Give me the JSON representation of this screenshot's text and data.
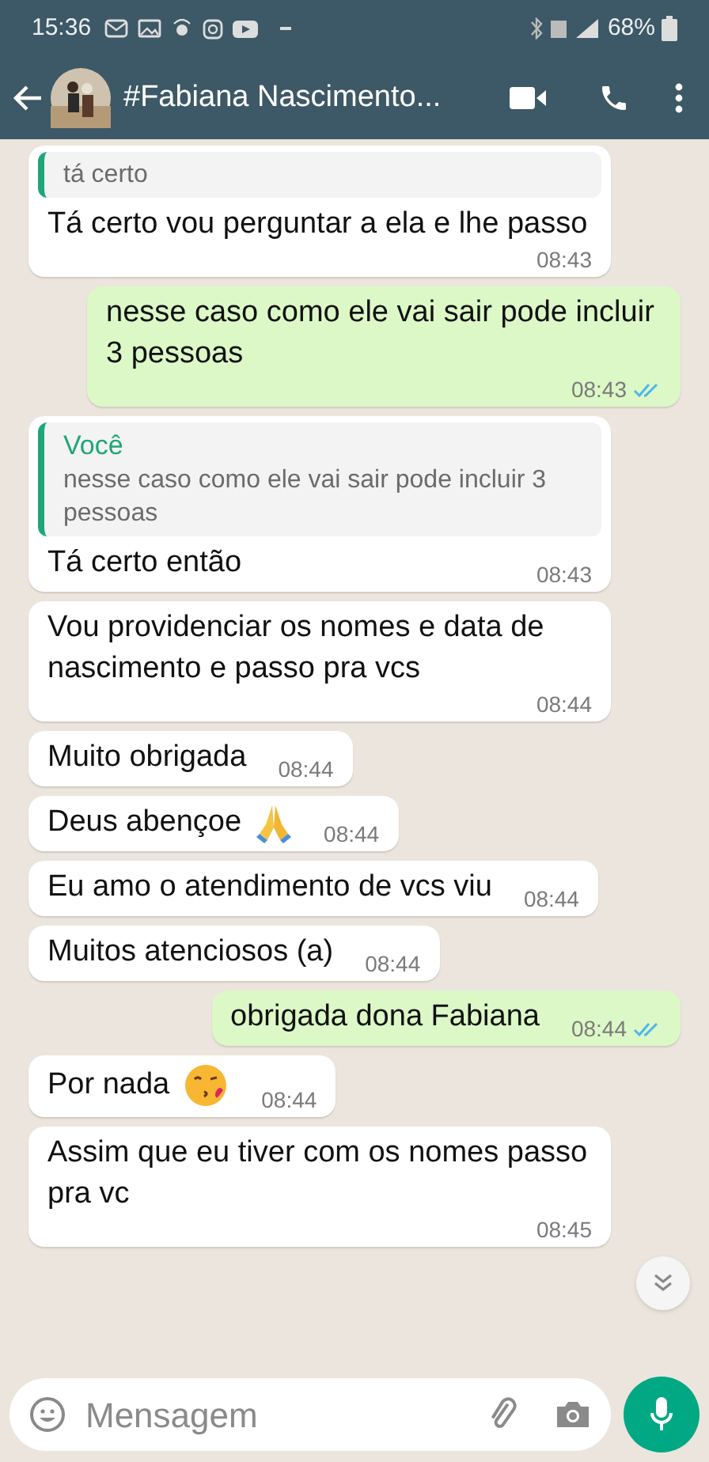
{
  "status_bar": {
    "time": "15:36",
    "battery_text": "68%"
  },
  "header": {
    "title": "#Fabiana Nascimento..."
  },
  "messages": [
    {
      "kind": "in",
      "quote_text": "tá certo",
      "text": "Tá certo vou perguntar a ela e lhe passo",
      "time": "08:43"
    },
    {
      "kind": "out",
      "text": "nesse caso como ele vai sair pode incluir 3 pessoas",
      "time": "08:43",
      "read": true
    },
    {
      "kind": "in",
      "quote_author": "Você",
      "quote_text": "nesse caso como ele vai sair pode incluir 3 pessoas",
      "text": "Tá certo então",
      "time": "08:43"
    },
    {
      "kind": "in",
      "text": "Vou providenciar os nomes e data de nascimento e passo pra vcs",
      "time": "08:44"
    },
    {
      "kind": "in",
      "text": "Muito obrigada",
      "time": "08:44"
    },
    {
      "kind": "in",
      "text": "Deus abençoe",
      "emoji": {
        "kind": "pray"
      },
      "time": "08:44"
    },
    {
      "kind": "in",
      "text": "Eu amo o atendimento de vcs viu",
      "time": "08:44"
    },
    {
      "kind": "in",
      "text": "Muitos atenciosos (a)",
      "time": "08:44"
    },
    {
      "kind": "out",
      "text": "obrigada dona Fabiana",
      "time": "08:44",
      "read": true
    },
    {
      "kind": "in",
      "text": "Por nada",
      "emoji": {
        "kind": "kiss"
      },
      "time": "08:44"
    },
    {
      "kind": "in",
      "text": "Assim que eu tiver com os nomes passo pra vc",
      "time": "08:45"
    }
  ],
  "composer": {
    "placeholder": "Mensagem"
  }
}
